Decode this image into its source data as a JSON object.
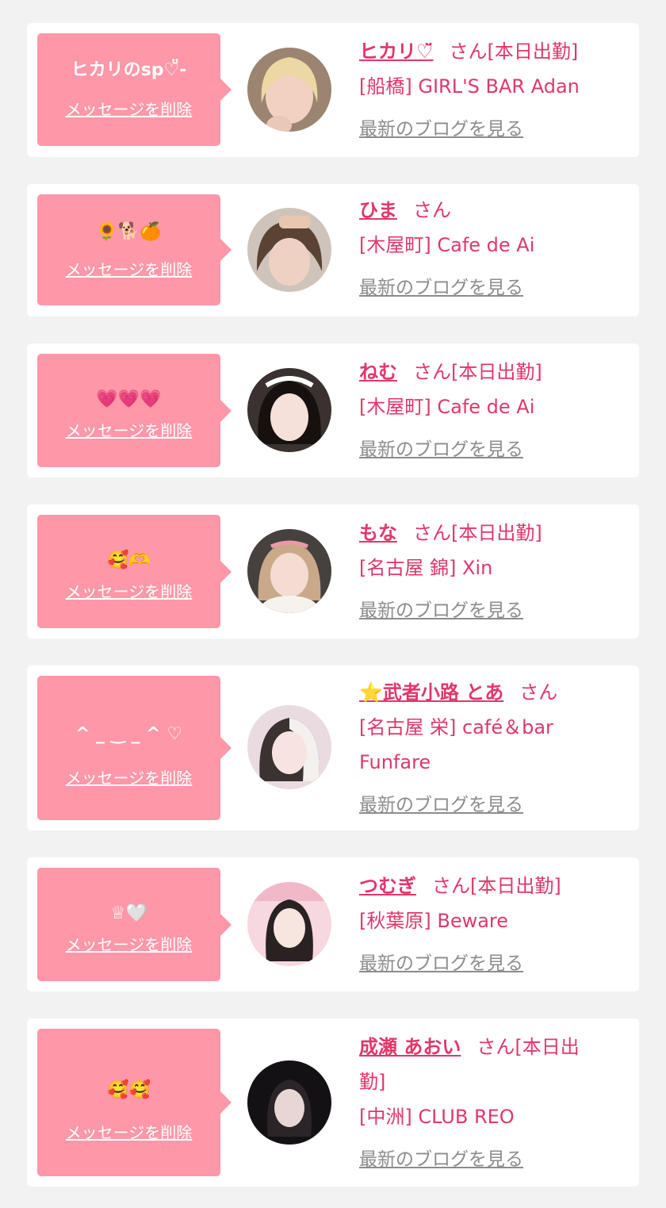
{
  "cards": [
    {
      "message": "ヒカリのsp♡̆̈-",
      "delete_label": "メッセージを削除",
      "avatar_icon": "profile-photo-icon",
      "name": "ヒカリ♡̆̈",
      "honorific": "さん",
      "status": "[本日出勤]",
      "shop": "[船橋] GIRL'S BAR Adan",
      "blog_label": "最新のブログを見る"
    },
    {
      "message": "🌻🐕🍊",
      "delete_label": "メッセージを削除",
      "avatar_icon": "profile-photo-icon",
      "name": "ひま",
      "honorific": "さん",
      "status": "",
      "shop": "[木屋町] Cafe de Ai",
      "blog_label": "最新のブログを見る"
    },
    {
      "message": "💗💗💗",
      "delete_label": "メッセージを削除",
      "avatar_icon": "profile-photo-icon",
      "name": "ねむ",
      "honorific": "さん",
      "status": "[本日出勤]",
      "shop": "[木屋町] Cafe de Ai",
      "blog_label": "最新のブログを見る"
    },
    {
      "message": "🥰🫶",
      "delete_label": "メッセージを削除",
      "avatar_icon": "profile-photo-icon",
      "name": "もな",
      "honorific": "さん",
      "status": "[本日出勤]",
      "shop": "[名古屋 錦] Xin",
      "blog_label": "最新のブログを見る"
    },
    {
      "message": "^ _ ‿ _ ^ ♡",
      "delete_label": "メッセージを削除",
      "avatar_icon": "profile-photo-icon",
      "name": "⭐武者小路 とあ",
      "honorific": "さん",
      "status": "",
      "shop": "[名古屋 栄] café＆bar",
      "shop2": "Funfare",
      "blog_label": "最新のブログを見る"
    },
    {
      "message": "♕🤍",
      "delete_label": "メッセージを削除",
      "avatar_icon": "profile-photo-icon",
      "name": "つむぎ",
      "honorific": "さん",
      "status": "[本日出勤]",
      "shop": "[秋葉原] Beware",
      "blog_label": "最新のブログを見る"
    },
    {
      "message": "🥰🥰",
      "delete_label": "メッセージを削除",
      "avatar_icon": "profile-photo-icon",
      "name": "成瀬 あおい",
      "honorific": "さん",
      "status": "[本日出",
      "status2": "勤]",
      "shop": "[中洲] CLUB REO",
      "blog_label": "最新のブログを見る"
    }
  ]
}
